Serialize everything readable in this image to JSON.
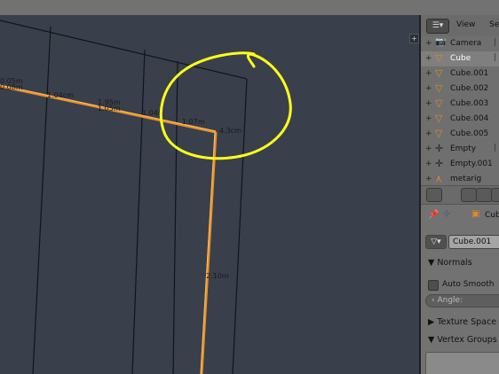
{
  "panel": {
    "menu": [
      "View",
      "Se"
    ],
    "outliner_items": [
      {
        "label": "Camera",
        "icon": "camera-icon"
      },
      {
        "label": "Cube",
        "icon": "mesh-icon"
      },
      {
        "label": "Cube.001",
        "icon": "mesh-icon"
      },
      {
        "label": "Cube.002",
        "icon": "mesh-icon"
      },
      {
        "label": "Cube.003",
        "icon": "mesh-icon"
      },
      {
        "label": "Cube.004",
        "icon": "mesh-icon"
      },
      {
        "label": "Cube.005",
        "icon": "mesh-icon"
      },
      {
        "label": "Empty",
        "icon": "empty-icon"
      },
      {
        "label": "Empty.001",
        "icon": "empty-icon"
      },
      {
        "label": "metarig",
        "icon": "armature-icon"
      }
    ],
    "context_label": "Cub",
    "mesh_name": "Cube.001",
    "normals_label": "Normals",
    "auto_smooth_label": "Auto Smooth",
    "angle_label": "Angle:",
    "texture_space_label": "Texture Space",
    "vertex_groups_label": "Vertex Groups"
  },
  "viewport": {
    "edge_labels": [
      "0.05m",
      "0.08m",
      "1.04cm",
      "1.95m",
      "1.05m",
      "1.04c",
      "1.07m",
      "4.3cm",
      "2.10m"
    ],
    "colors": {
      "edge_highlight": "#e8902a",
      "annotation": "#ffff1a",
      "background": "#39404c"
    }
  }
}
